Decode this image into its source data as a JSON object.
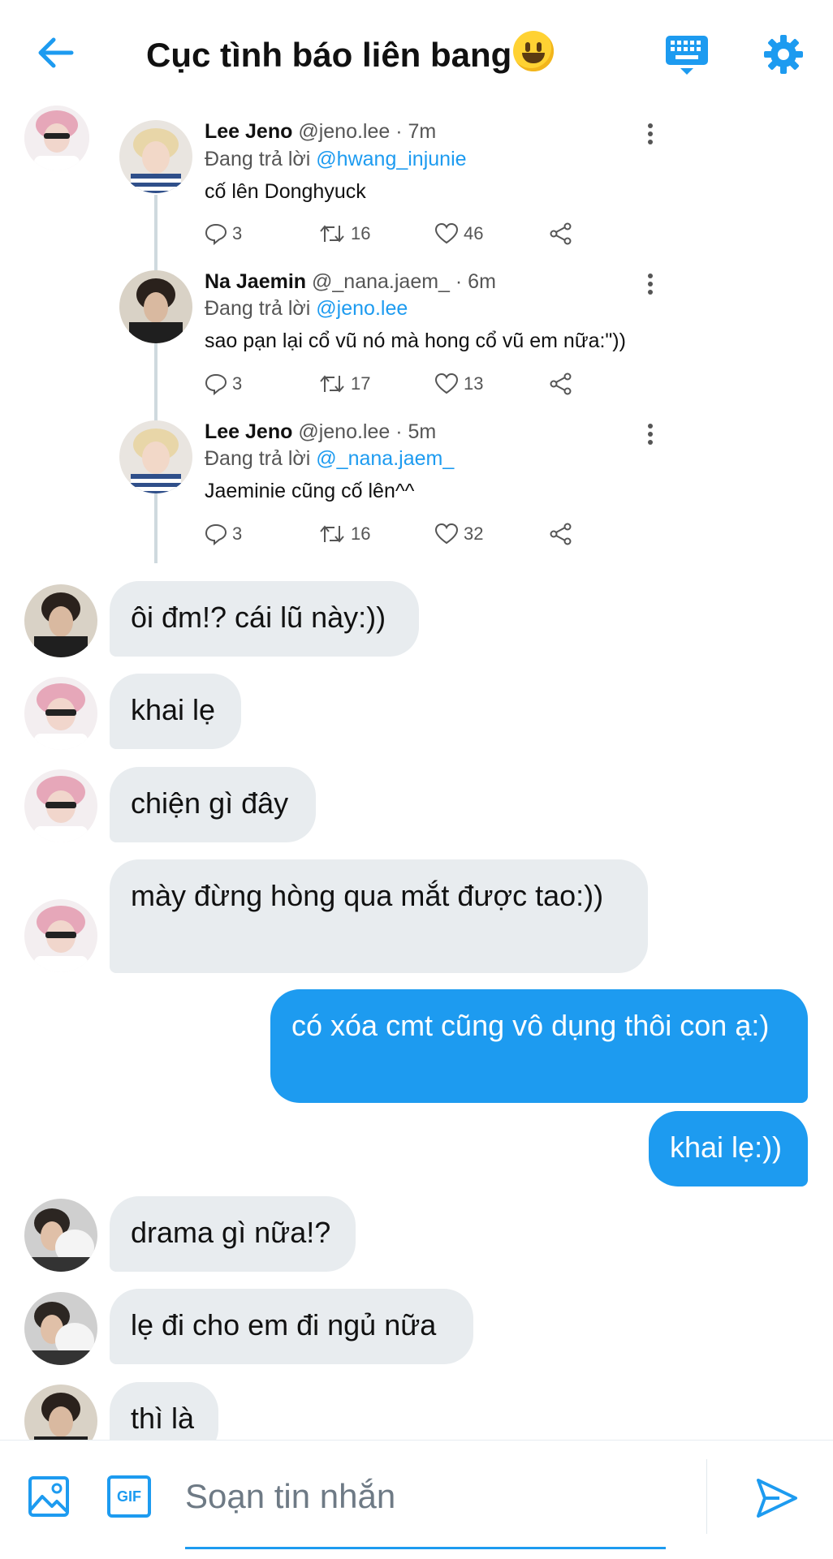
{
  "header": {
    "title": "Cục tình báo liên bang",
    "back_icon": "arrow-left-icon",
    "keyboard_icon": "keyboard-icon",
    "settings_icon": "gear-icon",
    "accent": "#1d9bf0"
  },
  "thread": [
    {
      "name": "Lee Jeno",
      "handle": "@jeno.lee",
      "time": "· 7m",
      "reply_prefix": "Đang trả lời",
      "reply_to": "@hwang_injunie",
      "text": "cố lên Donghyuck",
      "replies": "3",
      "retweets": "16",
      "likes": "46"
    },
    {
      "name": "Na Jaemin",
      "handle": "@_nana.jaem_",
      "time": "· 6m",
      "reply_prefix": "Đang trả lời",
      "reply_to": "@jeno.lee",
      "text": "sao pạn lại cổ vũ nó mà hong cổ vũ em nữa:\"))",
      "replies": "3",
      "retweets": "17",
      "likes": "13"
    },
    {
      "name": "Lee Jeno",
      "handle": "@jeno.lee",
      "time": "· 5m",
      "reply_prefix": "Đang trả lời",
      "reply_to": "@_nana.jaem_",
      "text": "Jaeminie cũng cố lên^^",
      "replies": "3",
      "retweets": "16",
      "likes": "32"
    }
  ],
  "messages": [
    {
      "dir": "in",
      "text": "ôi đm!? cái lũ này:))"
    },
    {
      "dir": "in",
      "text": "khai lẹ"
    },
    {
      "dir": "in",
      "text": "chiện gì đây"
    },
    {
      "dir": "in",
      "text": "mày đừng hòng qua mắt được tao:))"
    },
    {
      "dir": "out",
      "text": "có xóa cmt cũng vô dụng thôi con ạ:)"
    },
    {
      "dir": "out",
      "text": "khai lẹ:))"
    },
    {
      "dir": "in",
      "text": "drama gì nữa!?"
    },
    {
      "dir": "in",
      "text": "lẹ đi cho em đi ngủ nữa"
    },
    {
      "dir": "in",
      "text": "thì là"
    }
  ],
  "composer": {
    "placeholder": "Soạn tin nhắn",
    "image_icon": "image-icon",
    "gif_label": "GIF",
    "send_icon": "send-icon"
  }
}
